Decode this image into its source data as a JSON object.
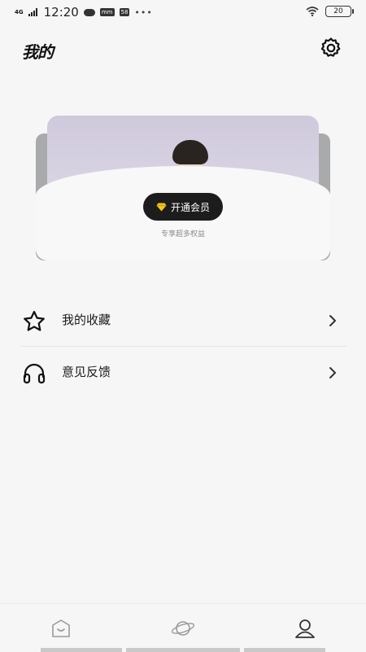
{
  "status_bar": {
    "network": "4G",
    "time": "12:20",
    "chip_1": "mm",
    "chip_2": "58",
    "dots": "•••",
    "battery": "20"
  },
  "header": {
    "title": "我的",
    "settings_icon": "gear-icon"
  },
  "membership_card": {
    "button_label": "开通会员",
    "subtitle": "专享超多权益",
    "button_icon": "diamond-icon"
  },
  "menu": [
    {
      "label": "我的收藏",
      "icon": "star-icon"
    },
    {
      "label": "意见反馈",
      "icon": "headphones-icon"
    }
  ],
  "bottom_nav": [
    {
      "icon": "home-icon"
    },
    {
      "icon": "planet-icon"
    },
    {
      "icon": "profile-icon",
      "active": true
    }
  ]
}
